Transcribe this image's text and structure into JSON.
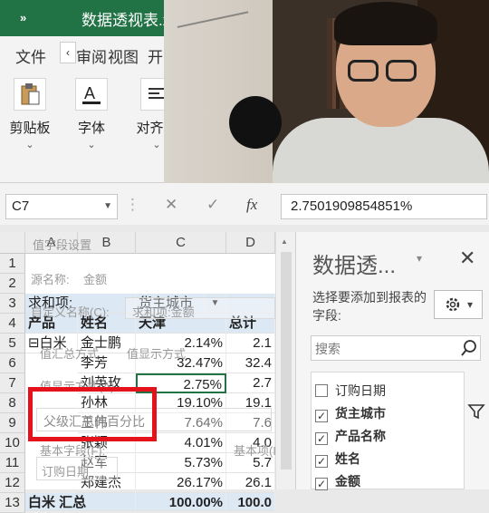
{
  "titlebar": {
    "quick_access": "»",
    "title": "数据透视表.xl"
  },
  "menubar": {
    "tab_file": "文件",
    "scroll_left": "‹",
    "tab_review": "审阅",
    "tab_view": "视图",
    "tab_developer": "开"
  },
  "ribbon": {
    "clipboard": "剪贴板",
    "font": "字体",
    "align": "对齐方"
  },
  "formula": {
    "cell_ref": "C7",
    "cancel_icon": "✕",
    "enter_icon": "✓",
    "fx": "fx",
    "value": "2.7501909854851%"
  },
  "grid": {
    "columns": [
      "A",
      "B",
      "C",
      "D"
    ],
    "rows": [
      "1",
      "2",
      "3",
      "4",
      "5",
      "6",
      "7",
      "8",
      "9",
      "10",
      "11",
      "12",
      "13"
    ],
    "r3": {
      "a": "求和项:",
      "c": "货主城市",
      "filter": "▼"
    },
    "r4": {
      "a": "产品",
      "b": "姓名",
      "c": "天津",
      "d": "总计"
    },
    "r5": {
      "a": "⊟白米",
      "b": "金士鹏",
      "c": "2.14%",
      "d": "2.1"
    },
    "r6": {
      "b": "李芳",
      "c": "32.47%",
      "d": "32.4"
    },
    "r7": {
      "b": "刘英玫",
      "c": "2.75%",
      "d": "2.7"
    },
    "r8": {
      "b": "孙林",
      "c": "19.10%",
      "d": "19.1"
    },
    "r9": {
      "b": "王伟",
      "c": "7.64%",
      "d": "7.6"
    },
    "r10": {
      "b": "张颖",
      "c": "4.01%",
      "d": "4.0"
    },
    "r11": {
      "b": "赵军",
      "c": "5.73%",
      "d": "5.7"
    },
    "r12": {
      "b": "郑建杰",
      "c": "26.17%",
      "d": "26.1"
    },
    "r13": {
      "a": "白米 汇总",
      "c": "100.00%",
      "d": "100.0"
    }
  },
  "dialog_ghost": {
    "title": "值字段设置",
    "source_label": "源名称:",
    "source_value": "金额",
    "custom_name": "自定义名称(C):",
    "custom_value": "求和项:金额",
    "summarize": "值汇总方式",
    "show_as": "值显示方式",
    "show_values_as": "值显示方式(A)",
    "selected": "父级汇总的百分比",
    "base_field": "基本字段(F):",
    "base_item": "基本项(I):",
    "order_date": "订购日期"
  },
  "panel": {
    "title": "数据透...",
    "dropdown": "▾",
    "close": "✕",
    "desc": "选择要添加到报表的字段:",
    "gear_dropdown": "▾",
    "search_placeholder": "搜索",
    "fields": [
      {
        "label": "订购日期",
        "checked": false,
        "mark": ""
      },
      {
        "label": "货主城市",
        "checked": true,
        "mark": "✓"
      },
      {
        "label": "产品名称",
        "checked": true,
        "mark": "✓"
      },
      {
        "label": "姓名",
        "checked": true,
        "mark": "✓"
      },
      {
        "label": "金额",
        "checked": true,
        "mark": "✓"
      }
    ]
  },
  "colors": {
    "excel_green": "#217346",
    "highlight_red": "#e5121b",
    "header_blue": "#dde8f5"
  }
}
